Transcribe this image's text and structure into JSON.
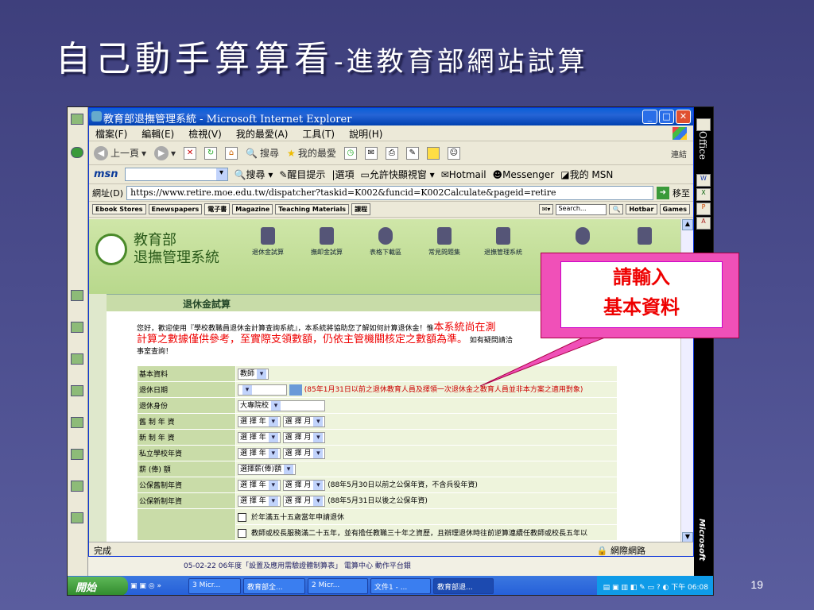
{
  "slide": {
    "title_main": "自己動手算算看",
    "title_sub": "-進教育部網站試算",
    "page_number": "19"
  },
  "window": {
    "title": "教育部退撫管理系統 - Microsoft Internet Explorer"
  },
  "menu": [
    "檔案(F)",
    "編輯(E)",
    "檢視(V)",
    "我的最愛(A)",
    "工具(T)",
    "說明(H)"
  ],
  "toolbar": {
    "back": "上一頁",
    "search": "搜尋",
    "favorites": "我的最愛",
    "links": "連結"
  },
  "msn": {
    "logo": "msn",
    "search": "搜尋",
    "remind": "醒目提示",
    "options": "選項",
    "popup": "允許快顯視窗",
    "hotmail": "Hotmail",
    "messenger": "Messenger",
    "mymsn": "我的 MSN"
  },
  "address": {
    "label": "網址(D)",
    "url": "https://www.retire.moe.edu.tw/dispatcher?taskid=K002&funcid=K002Calculate&pageid=retire",
    "go": "移至"
  },
  "custom_toolbar": [
    "Ebook Stores",
    "Enewspapers",
    "電子書",
    "Magazine",
    "Teaching Materials",
    "課程"
  ],
  "custom_right": {
    "search_placeholder": "Search...",
    "hotbar": "Hotbar",
    "games": "Games"
  },
  "site": {
    "org": "教育部",
    "system": "退撫管理系統",
    "nav": [
      "退休金試算",
      "撫卹金試算",
      "表格下載區",
      "常見問題集",
      "退撫管理系統"
    ],
    "section": "退休金試算"
  },
  "intro": {
    "line1": "您好，歡迎使用『學校教職員退休金計算查詢系統』，本系統將協助您了解如何計算退休金！惟",
    "red1": "本系統尚在測",
    "red2": "計算之數據僅供參考，至實際支領數額，仍依主管機關核定之數額為準。",
    "line2": "如有疑問請洽",
    "line3": "事室查詢！"
  },
  "form": [
    {
      "label": "基本資料",
      "value": "教師"
    },
    {
      "label": "退休日期",
      "note": "(85年1月31日以前之退休教育人員及擇領一次退休金之教育人員並非本方案之適用對象)"
    },
    {
      "label": "退休身份",
      "value": "大專院校"
    },
    {
      "label": "舊 制 年 資",
      "y": "選 擇 年",
      "m": "選 擇 月"
    },
    {
      "label": "新 制 年 資",
      "y": "選 擇 年",
      "m": "選 擇 月"
    },
    {
      "label": "私立學校年資",
      "y": "選 擇 年",
      "m": "選 擇 月"
    },
    {
      "label": "薪 (俸) 額",
      "value": "選擇薪(俸)額"
    },
    {
      "label": "公保舊制年資",
      "y": "選 擇 年",
      "m": "選 擇 月",
      "note": "(88年5月30日以前之公保年資，不含兵役年資)"
    },
    {
      "label": "公保新制年資",
      "y": "選 擇 年",
      "m": "選 擇 月",
      "note": "(88年5月31日以後之公保年資)"
    },
    {
      "opt1": "於年滿五十五歲當年申請退休",
      "opt2": "教師或校長服務滿二十五年，並有擔任教職三十年之資歷，且辦理退休時往前逆算連續任教師或校長五年以"
    }
  ],
  "callout": {
    "line1": "請輸入",
    "line2": "基本資料"
  },
  "status": {
    "left": "完成",
    "right": "網際網路"
  },
  "bg_peek": "05-02-22 06年度「設置及應用需驗證體制算表」  電算中心  動作平台銀",
  "taskbar": {
    "start": "開始",
    "tasks": [
      "3 Micr...",
      "教育部全...",
      "2 Micr...",
      "文件1 - ...",
      "教育部退..."
    ],
    "clock": "下午 06:08"
  },
  "office_bar": {
    "label": "Office",
    "brand": "Microsoft"
  }
}
